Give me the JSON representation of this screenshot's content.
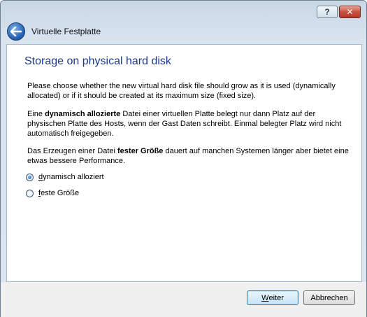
{
  "window": {
    "title": "Virtuelle Festplatte",
    "help_label": "?",
    "close_label": "✕"
  },
  "page": {
    "heading": "Storage on physical hard disk",
    "intro_line1": "Please choose whether the new virtual hard disk file should grow as it is used (dynamically",
    "intro_line2": "allocated) or if it should be created at its maximum size (fixed size).",
    "dyn_prefix": "Eine ",
    "dyn_bold": "dynamisch allozierte",
    "dyn_line1_rest": " Datei einer virtuellen Platte belegt nur dann Platz auf der",
    "dyn_line2": "physischen Platte des Hosts, wenn der Gast Daten schreibt. Einmal belegter Platz wird nicht",
    "dyn_line3": "automatisch freigegeben.",
    "fixed_prefix": "Das Erzeugen einer Datei ",
    "fixed_bold": "fester Größe",
    "fixed_line1_rest": " dauert auf manchen Systemen länger aber bietet eine",
    "fixed_line2": "etwas bessere Performance."
  },
  "options": [
    {
      "key": "d",
      "rest": "ynamisch alloziert",
      "selected": true
    },
    {
      "key": "f",
      "rest": "este Größe",
      "selected": false
    }
  ],
  "buttons": {
    "next_key": "W",
    "next_rest": "eiter",
    "cancel": "Abbrechen"
  }
}
